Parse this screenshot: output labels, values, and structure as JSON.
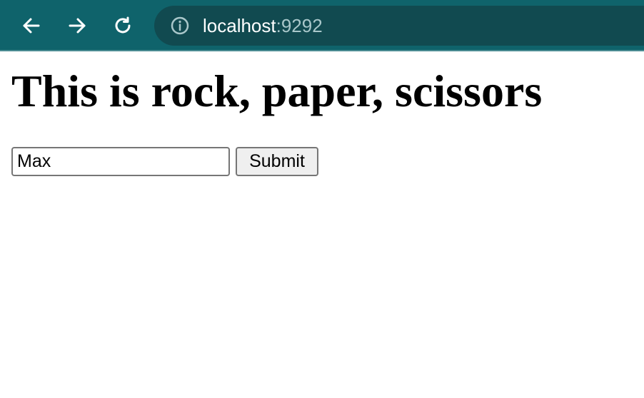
{
  "browser": {
    "nav": {
      "back_icon": "arrow-left-icon",
      "forward_icon": "arrow-right-icon",
      "reload_icon": "reload-icon"
    },
    "address_bar": {
      "site_info_icon": "info-icon",
      "host": "localhost",
      "port": ":9292"
    },
    "colors": {
      "toolbar": "#0f636b",
      "omnibox": "#114a50",
      "port_text": "#a9c7ca"
    }
  },
  "page": {
    "title": "This is rock, paper, scissors",
    "form": {
      "name_value": "Max",
      "submit_label": "Submit"
    }
  }
}
